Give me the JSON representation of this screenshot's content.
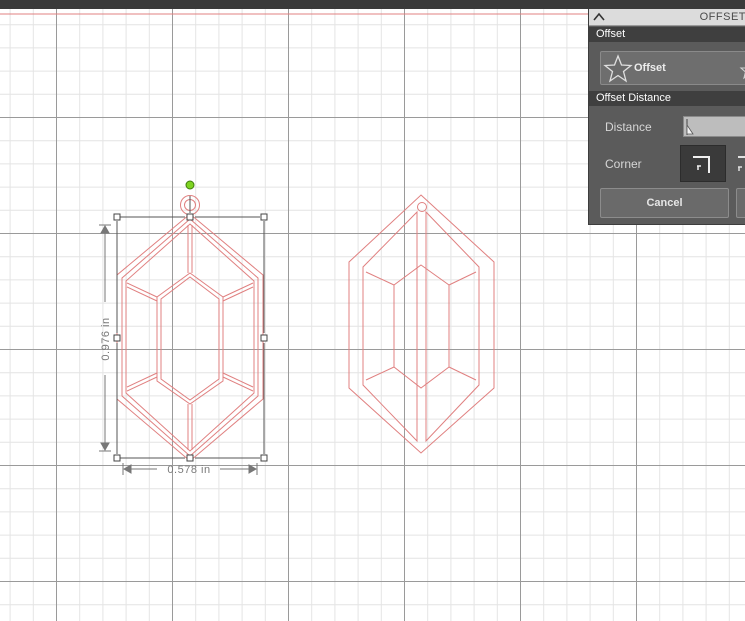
{
  "panel": {
    "title": "OFFSET",
    "section_offset": "Offset",
    "offset_button_label": "Offset",
    "section_distance": "Offset Distance",
    "distance_label": "Distance",
    "corner_label": "Corner",
    "cancel_label": "Cancel"
  },
  "canvas": {
    "height_dimension": "0.976 in",
    "width_dimension": "0.578 in"
  },
  "colors": {
    "cut_line": "#e08080",
    "rotate_handle": "#7ed321",
    "grid_minor": "#e4e4e4",
    "grid_major": "#9a9a9a"
  },
  "icons": [
    "chevron-up-icon",
    "star-icon",
    "slider-thumb-icon",
    "corner-square-icon",
    "corner-round-icon"
  ]
}
